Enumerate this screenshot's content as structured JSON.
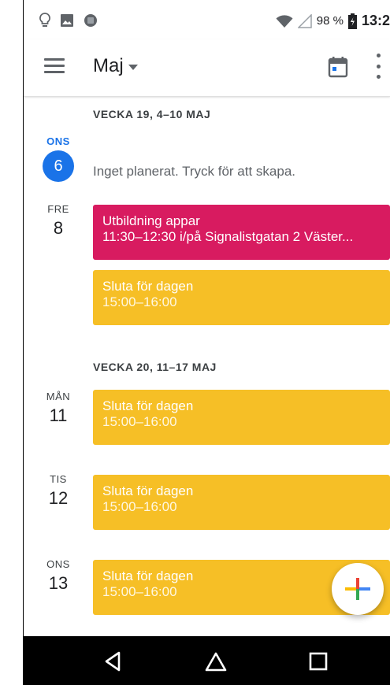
{
  "status_bar": {
    "icons": [
      "lightbulb-icon",
      "image-icon",
      "app-icon",
      "wifi-icon",
      "signal-icon",
      "battery-icon"
    ],
    "battery": "98 %",
    "time": "13:2"
  },
  "app_bar": {
    "month": "Maj",
    "icons": [
      "menu-icon",
      "caret-down-icon",
      "calendar-today-icon",
      "more-vert-icon"
    ]
  },
  "agenda": {
    "weeks": [
      {
        "header": "VECKA 19, 4–10 MAJ",
        "days": [
          {
            "dow": "ONS",
            "num": "6",
            "today": true,
            "note": "Inget planerat. Tryck för att skapa."
          },
          {
            "dow": "FRE",
            "num": "8",
            "events": [
              {
                "title": "Utbildning appar",
                "sub": "11:30–12:30 i/på Signalistgatan 2 Väster...",
                "color": "#d81b60"
              },
              {
                "title": "Sluta för dagen",
                "sub": "15:00–16:00",
                "color": "#f6bf26"
              }
            ]
          }
        ]
      },
      {
        "header": "VECKA 20, 11–17 MAJ",
        "days": [
          {
            "dow": "MÅN",
            "num": "11",
            "events": [
              {
                "title": "Sluta för dagen",
                "sub": "15:00–16:00",
                "color": "#f6bf26"
              }
            ]
          },
          {
            "dow": "TIS",
            "num": "12",
            "events": [
              {
                "title": "Sluta för dagen",
                "sub": "15:00–16:00",
                "color": "#f6bf26"
              }
            ]
          },
          {
            "dow": "ONS",
            "num": "13",
            "events": [
              {
                "title": "Sluta för dagen",
                "sub": "15:00–16:00",
                "color": "#f6bf26"
              }
            ]
          }
        ]
      }
    ]
  },
  "fab": {
    "icon": "plus-icon",
    "colors": [
      "#ea4335",
      "#4285f4",
      "#34a853",
      "#fbbc05"
    ]
  },
  "nav_bar": {
    "icons": [
      "back-icon",
      "home-icon",
      "recents-icon"
    ]
  },
  "colors": {
    "accent": "#1a73e8",
    "event_pink": "#d81b60",
    "event_yellow": "#f6bf26"
  }
}
